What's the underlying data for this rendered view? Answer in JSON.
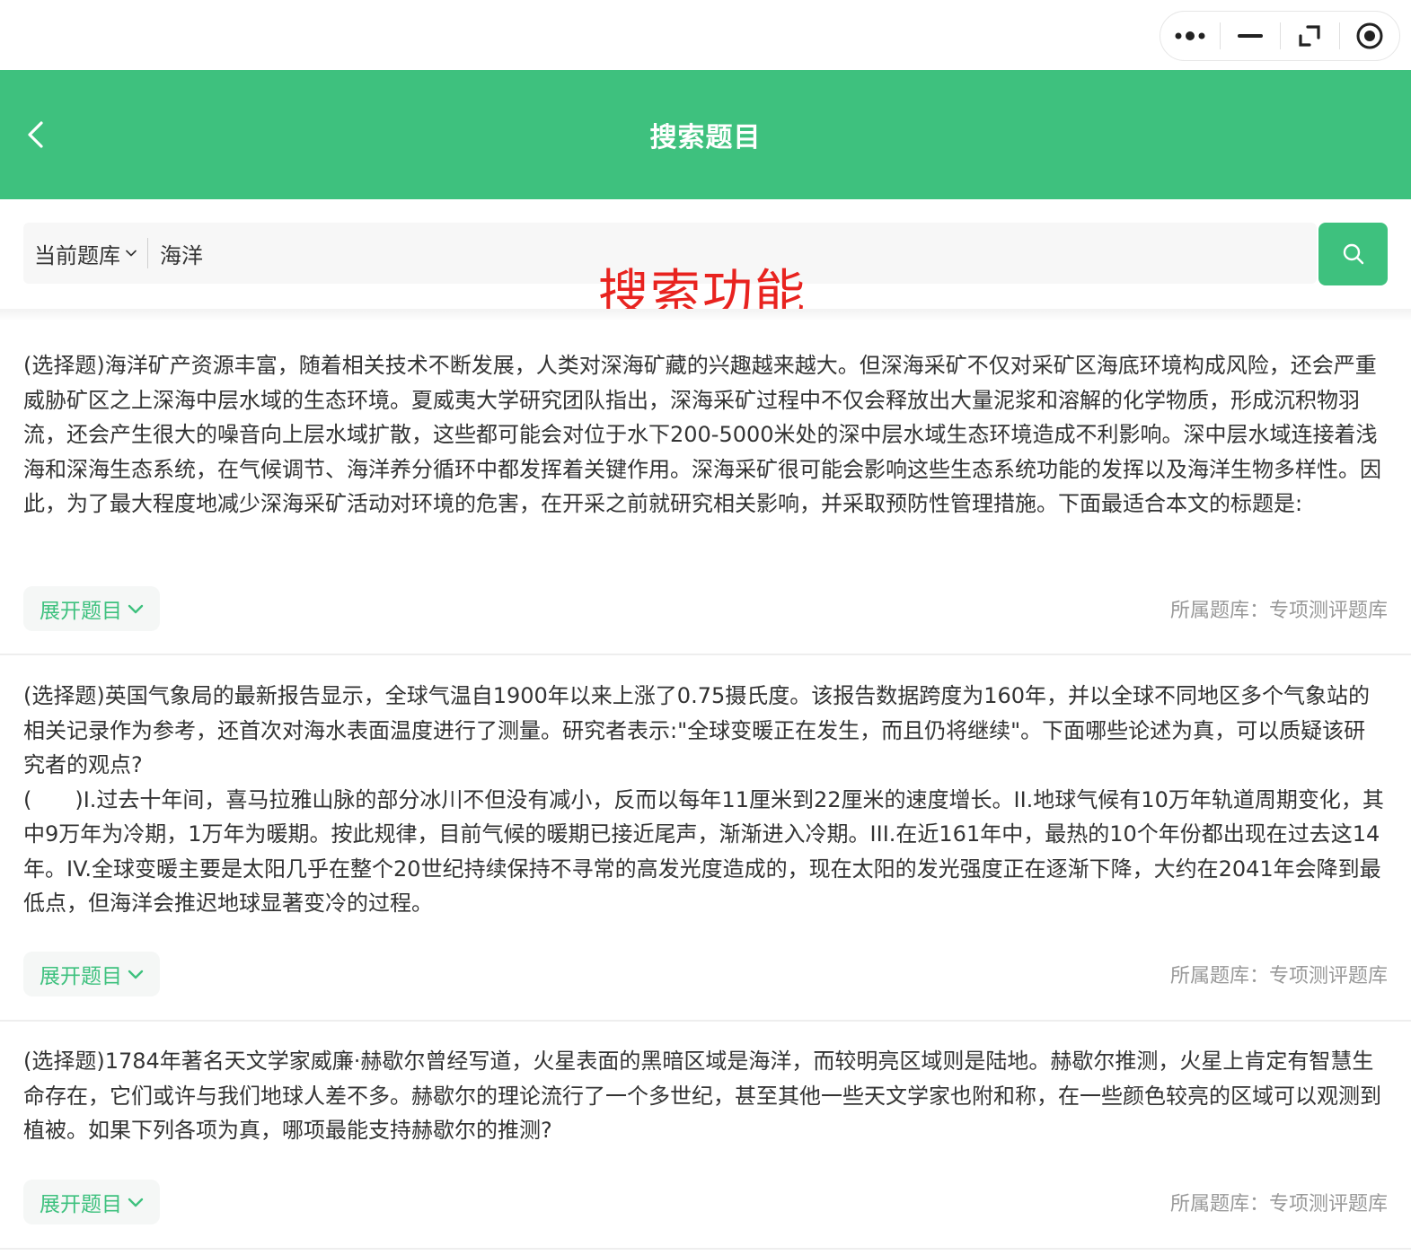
{
  "header": {
    "title": "搜索题目"
  },
  "search": {
    "scope_label": "当前题库",
    "query": "海洋",
    "annotation": "搜索功能"
  },
  "questions": [
    {
      "text": "(选择题)海洋矿产资源丰富，随着相关技术不断发展，人类对深海矿藏的兴趣越来越大。但深海采矿不仅对采矿区海底环境构成风险，还会严重威胁矿区之上深海中层水域的生态环境。夏威夷大学研究团队指出，深海采矿过程中不仅会释放出大量泥浆和溶解的化学物质，形成沉积物羽流，还会产生很大的噪音向上层水域扩散，这些都可能会对位于水下200-5000米处的深中层水域生态环境造成不利影响。深中层水域连接着浅海和深海生态系统，在气候调节、海洋养分循环中都发挥着关键作用。深海采矿很可能会影响这些生态系统功能的发挥以及海洋生物多样性。因此，为了最大程度地减少深海采矿活动对环境的危害，在开采之前就研究相关影响，并采取预防性管理措施。下面最适合本文的标题是:",
      "expand_label": "展开题目",
      "bank": "所属题库：专项测评题库"
    },
    {
      "text": "(选择题)英国气象局的最新报告显示，全球气温自1900年以来上涨了0.75摄氏度。该报告数据跨度为160年，并以全球不同地区多个气象站的相关记录作为参考，还首次对海水表面温度进行了测量。研究者表示:\"全球变暖正在发生，而且仍将继续\"。下面哪些论述为真，可以质疑该研究者的观点?\n(　　)I.过去十年间，喜马拉雅山脉的部分冰川不但没有减小，反而以每年11厘米到22厘米的速度增长。II.地球气候有10万年轨道周期变化，其中9万年为冷期，1万年为暖期。按此规律，目前气候的暖期已接近尾声，渐渐进入冷期。III.在近161年中，最热的10个年份都出现在过去这14年。IV.全球变暖主要是太阳几乎在整个20世纪持续保持不寻常的高发光度造成的，现在太阳的发光强度正在逐渐下降，大约在2041年会降到最低点，但海洋会推迟地球显著变冷的过程。",
      "expand_label": "展开题目",
      "bank": "所属题库：专项测评题库"
    },
    {
      "text": "(选择题)1784年著名天文学家威廉·赫歇尔曾经写道，火星表面的黑暗区域是海洋，而较明亮区域则是陆地。赫歇尔推测，火星上肯定有智慧生命存在，它们或许与我们地球人差不多。赫歇尔的理论流行了一个多世纪，甚至其他一些天文学家也附和称，在一些颜色较亮的区域可以观测到植被。如果下列各项为真，哪项最能支持赫歇尔的推测?",
      "expand_label": "展开题目",
      "bank": "所属题库：专项测评题库"
    }
  ]
}
